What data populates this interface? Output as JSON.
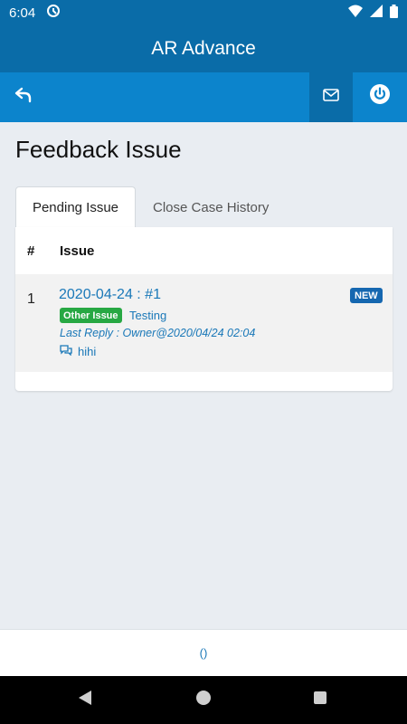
{
  "status_bar": {
    "time": "6:04"
  },
  "app_bar": {
    "title": "AR Advance"
  },
  "page": {
    "title": "Feedback Issue"
  },
  "tabs": [
    {
      "label": "Pending Issue",
      "active": true
    },
    {
      "label": "Close Case History",
      "active": false
    }
  ],
  "table": {
    "headers": {
      "number": "#",
      "issue": "Issue"
    },
    "rows": [
      {
        "index": "1",
        "title": "2020-04-24 : #1",
        "badge_new": "NEW",
        "category": "Other Issue",
        "subject": "Testing",
        "last_reply": "Last Reply : Owner@2020/04/24 02:04",
        "reply_text": "hihi"
      }
    ]
  },
  "footer": {
    "text": "()"
  },
  "colors": {
    "primary_dark": "#0a6ca8",
    "primary": "#0c84cc",
    "link": "#1a78b8",
    "badge_new": "#1567b0",
    "badge_category": "#27a843"
  },
  "icons": [
    "back-icon",
    "mail-icon",
    "power-icon",
    "comment-icon",
    "wifi-icon",
    "signal-icon",
    "battery-icon"
  ]
}
